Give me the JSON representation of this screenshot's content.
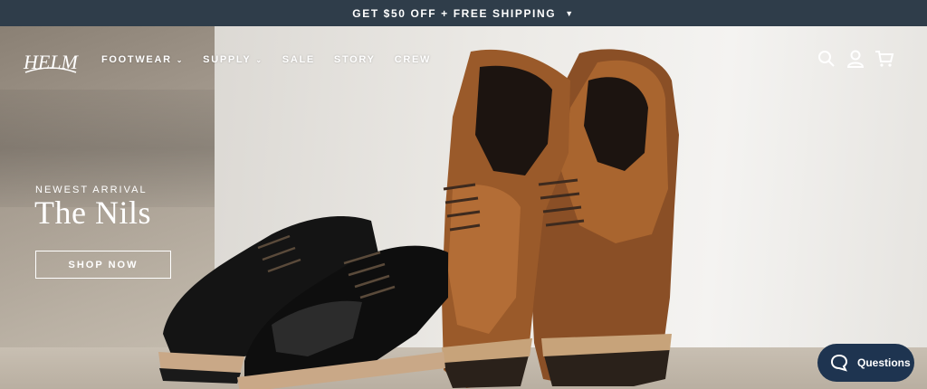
{
  "announcement": {
    "text": "GET $50 OFF + FREE SHIPPING",
    "icon": "chevron-down-icon"
  },
  "header": {
    "logo_text": "HELM",
    "nav": [
      {
        "label": "FOOTWEAR",
        "has_dropdown": true
      },
      {
        "label": "SUPPLY",
        "has_dropdown": true
      },
      {
        "label": "SALE",
        "has_dropdown": false
      },
      {
        "label": "STORY",
        "has_dropdown": false
      },
      {
        "label": "CREW",
        "has_dropdown": false
      }
    ],
    "icons": [
      "search-icon",
      "account-icon",
      "cart-icon"
    ]
  },
  "hero": {
    "eyebrow": "NEWEST ARRIVAL",
    "title": "The Nils",
    "cta_label": "SHOP NOW"
  },
  "chat": {
    "label": "Questions",
    "icon": "chat-bubble-icon"
  },
  "colors": {
    "announcement_bg": "#2f3d4a",
    "chat_bg": "#1e3450",
    "text_light": "#ffffff"
  }
}
